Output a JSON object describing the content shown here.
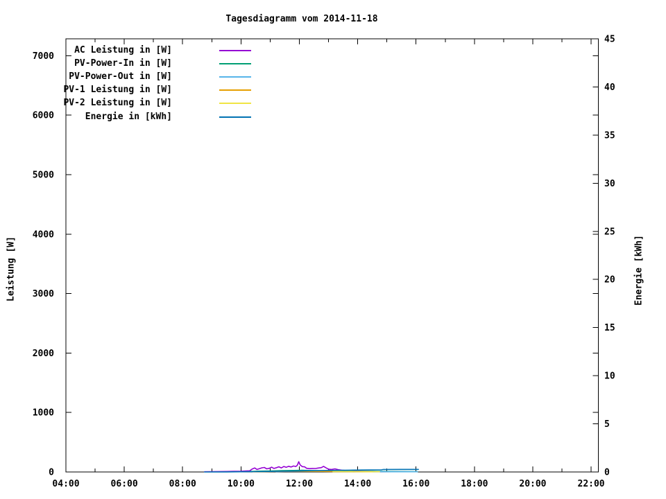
{
  "chart_data": {
    "type": "line",
    "title": "Tagesdiagramm vom 2014-11-18",
    "background": "#ffffff",
    "grid": false,
    "legend_position": "top-left-inside",
    "x_axis": {
      "unit": "time-of-day",
      "range_hours": [
        4,
        22.25
      ],
      "minor_tick_step_hours": 1,
      "major_tick_step_hours": 2,
      "tick_labels": [
        "04:00",
        "06:00",
        "08:00",
        "10:00",
        "12:00",
        "14:00",
        "16:00",
        "18:00",
        "20:00",
        "22:00"
      ],
      "tick_label_hours": [
        4,
        6,
        8,
        10,
        12,
        14,
        16,
        18,
        20,
        22
      ]
    },
    "y_left": {
      "label": "Leistung [W]",
      "range": [
        0,
        7285
      ],
      "tick_step": 1000,
      "ticks": [
        0,
        1000,
        2000,
        3000,
        4000,
        5000,
        6000,
        7000
      ]
    },
    "y_right": {
      "label": "Energie [kWh]",
      "range": [
        0,
        45
      ],
      "tick_step": 5,
      "ticks": [
        0,
        5,
        10,
        15,
        20,
        25,
        30,
        35,
        40,
        45
      ]
    },
    "series": [
      {
        "name": "AC Leistung in [W]",
        "color": "#9400d3",
        "axis": "left",
        "points": [
          [
            8.75,
            3
          ],
          [
            9.0,
            5
          ],
          [
            9.25,
            7
          ],
          [
            9.5,
            8
          ],
          [
            9.75,
            10
          ],
          [
            10.0,
            13
          ],
          [
            10.17,
            16
          ],
          [
            10.3,
            20
          ],
          [
            10.38,
            48
          ],
          [
            10.47,
            68
          ],
          [
            10.55,
            42
          ],
          [
            10.63,
            55
          ],
          [
            10.72,
            70
          ],
          [
            10.8,
            76
          ],
          [
            10.88,
            52
          ],
          [
            10.97,
            62
          ],
          [
            11.05,
            80
          ],
          [
            11.13,
            60
          ],
          [
            11.22,
            72
          ],
          [
            11.3,
            88
          ],
          [
            11.38,
            68
          ],
          [
            11.47,
            92
          ],
          [
            11.55,
            78
          ],
          [
            11.63,
            96
          ],
          [
            11.72,
            84
          ],
          [
            11.8,
            100
          ],
          [
            11.88,
            92
          ],
          [
            11.93,
            112
          ],
          [
            11.98,
            172
          ],
          [
            12.03,
            118
          ],
          [
            12.1,
            90
          ],
          [
            12.18,
            86
          ],
          [
            12.25,
            62
          ],
          [
            12.35,
            56
          ],
          [
            12.45,
            60
          ],
          [
            12.55,
            58
          ],
          [
            12.65,
            66
          ],
          [
            12.75,
            72
          ],
          [
            12.83,
            94
          ],
          [
            12.92,
            68
          ],
          [
            13.0,
            48
          ],
          [
            13.1,
            42
          ],
          [
            13.22,
            52
          ],
          [
            13.33,
            38
          ],
          [
            13.45,
            30
          ],
          [
            13.6,
            24
          ],
          [
            13.78,
            18
          ],
          [
            14.0,
            14
          ],
          [
            14.25,
            11
          ],
          [
            14.5,
            9
          ],
          [
            14.75,
            7
          ],
          [
            15.0,
            6
          ],
          [
            15.25,
            5
          ],
          [
            15.5,
            4
          ],
          [
            15.65,
            3
          ]
        ]
      },
      {
        "name": "PV-Power-In in [W]",
        "color": "#009e73",
        "axis": "left",
        "points": [
          [
            10.3,
            8
          ],
          [
            10.6,
            14
          ],
          [
            11.0,
            18
          ],
          [
            11.4,
            22
          ],
          [
            11.8,
            26
          ],
          [
            12.1,
            28
          ],
          [
            12.4,
            24
          ],
          [
            12.7,
            21
          ],
          [
            13.0,
            18
          ],
          [
            13.3,
            16
          ],
          [
            13.6,
            14
          ],
          [
            13.9,
            12
          ],
          [
            14.2,
            11
          ],
          [
            14.5,
            10
          ],
          [
            14.8,
            9
          ],
          [
            15.1,
            8
          ],
          [
            15.5,
            7
          ],
          [
            16.05,
            6
          ]
        ]
      },
      {
        "name": "PV-Power-Out in [W]",
        "color": "#56b4e9",
        "axis": "left",
        "points": [
          [
            11.2,
            6
          ],
          [
            11.5,
            9
          ],
          [
            11.8,
            12
          ],
          [
            12.1,
            14
          ],
          [
            12.4,
            12
          ],
          [
            12.7,
            11
          ],
          [
            13.0,
            10
          ],
          [
            13.3,
            9
          ],
          [
            13.6,
            8
          ],
          [
            14.0,
            7
          ],
          [
            14.4,
            6
          ],
          [
            14.8,
            5
          ],
          [
            15.2,
            4
          ],
          [
            15.6,
            4
          ],
          [
            16.05,
            3
          ]
        ]
      },
      {
        "name": "PV-1 Leistung in [W]",
        "color": "#e69f00",
        "axis": "left",
        "points": [
          [
            10.4,
            5
          ],
          [
            10.8,
            7
          ],
          [
            11.2,
            9
          ],
          [
            11.6,
            10
          ],
          [
            12.0,
            12
          ],
          [
            12.4,
            10
          ],
          [
            12.8,
            9
          ],
          [
            13.2,
            7
          ],
          [
            13.6,
            6
          ],
          [
            14.0,
            5
          ],
          [
            14.5,
            4
          ]
        ]
      },
      {
        "name": "PV-2 Leistung in [W]",
        "color": "#f0e442",
        "axis": "left",
        "points": [
          [
            13.15,
            6
          ],
          [
            13.35,
            8
          ],
          [
            13.55,
            6
          ],
          [
            13.75,
            8
          ],
          [
            13.95,
            6
          ],
          [
            14.15,
            7
          ],
          [
            14.35,
            5
          ],
          [
            14.55,
            6
          ],
          [
            14.75,
            5
          ]
        ]
      },
      {
        "name": "Energie in [kWh]",
        "color": "#0072b2",
        "axis": "right",
        "points": [
          [
            8.75,
            0.0
          ],
          [
            9.5,
            0.01
          ],
          [
            10.2,
            0.03
          ],
          [
            11.0,
            0.06
          ],
          [
            11.7,
            0.09
          ],
          [
            12.3,
            0.13
          ],
          [
            13.0,
            0.16
          ],
          [
            13.7,
            0.19
          ],
          [
            14.4,
            0.21
          ],
          [
            14.82,
            0.22
          ],
          [
            14.88,
            0.26
          ],
          [
            15.5,
            0.27
          ],
          [
            16.08,
            0.27
          ]
        ]
      }
    ]
  }
}
